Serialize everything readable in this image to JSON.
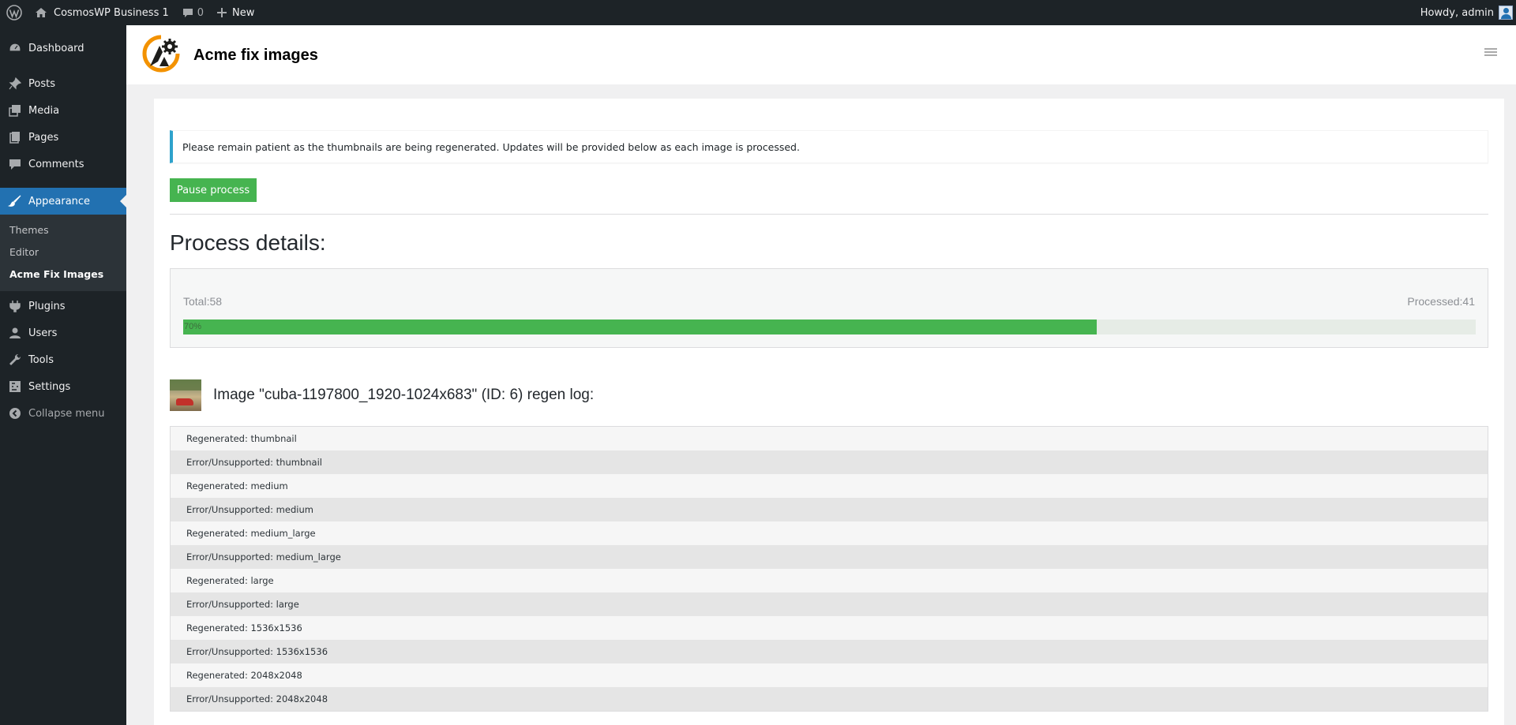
{
  "admin_bar": {
    "site_name": "CosmosWP Business 1",
    "comments_count": "0",
    "new_label": "New",
    "howdy": "Howdy, admin"
  },
  "sidebar": {
    "items": [
      {
        "label": "Dashboard",
        "icon": "dashboard-icon"
      },
      {
        "label": "Posts",
        "icon": "pin-icon"
      },
      {
        "label": "Media",
        "icon": "media-icon"
      },
      {
        "label": "Pages",
        "icon": "pages-icon"
      },
      {
        "label": "Comments",
        "icon": "comment-icon"
      },
      {
        "label": "Appearance",
        "icon": "brush-icon",
        "active": true
      },
      {
        "label": "Plugins",
        "icon": "plug-icon"
      },
      {
        "label": "Users",
        "icon": "user-icon"
      },
      {
        "label": "Tools",
        "icon": "wrench-icon"
      },
      {
        "label": "Settings",
        "icon": "settings-icon"
      },
      {
        "label": "Collapse menu",
        "icon": "collapse-icon"
      }
    ],
    "submenu": [
      {
        "label": "Themes"
      },
      {
        "label": "Editor"
      },
      {
        "label": "Acme Fix Images",
        "current": true
      }
    ]
  },
  "header": {
    "title": "Acme fix images"
  },
  "notice": {
    "text": "Please remain patient as the thumbnails are being regenerated. Updates will be provided below as each image is processed."
  },
  "pause_button": {
    "label": "Pause process"
  },
  "process": {
    "title": "Process details:",
    "total_text": "Total:58",
    "processed_text": "Processed:41",
    "progress_label": "70%",
    "progress_fraction": 0.7069
  },
  "image_log": {
    "heading": "Image \"cuba-1197800_1920-1024x683\" (ID: 6) regen log:",
    "rows": [
      "Regenerated: thumbnail",
      "Error/Unsupported: thumbnail",
      "Regenerated: medium",
      "Error/Unsupported: medium",
      "Regenerated: medium_large",
      "Error/Unsupported: medium_large",
      "Regenerated: large",
      "Error/Unsupported: large",
      "Regenerated: 1536x1536",
      "Error/Unsupported: 1536x1536",
      "Regenerated: 2048x2048",
      "Error/Unsupported: 2048x2048"
    ]
  },
  "colors": {
    "admin_dark": "#1d2327",
    "accent_blue": "#2271b1",
    "success_green": "#46b450",
    "notice_border": "#2ea2cc",
    "logo_orange": "#f39200"
  }
}
